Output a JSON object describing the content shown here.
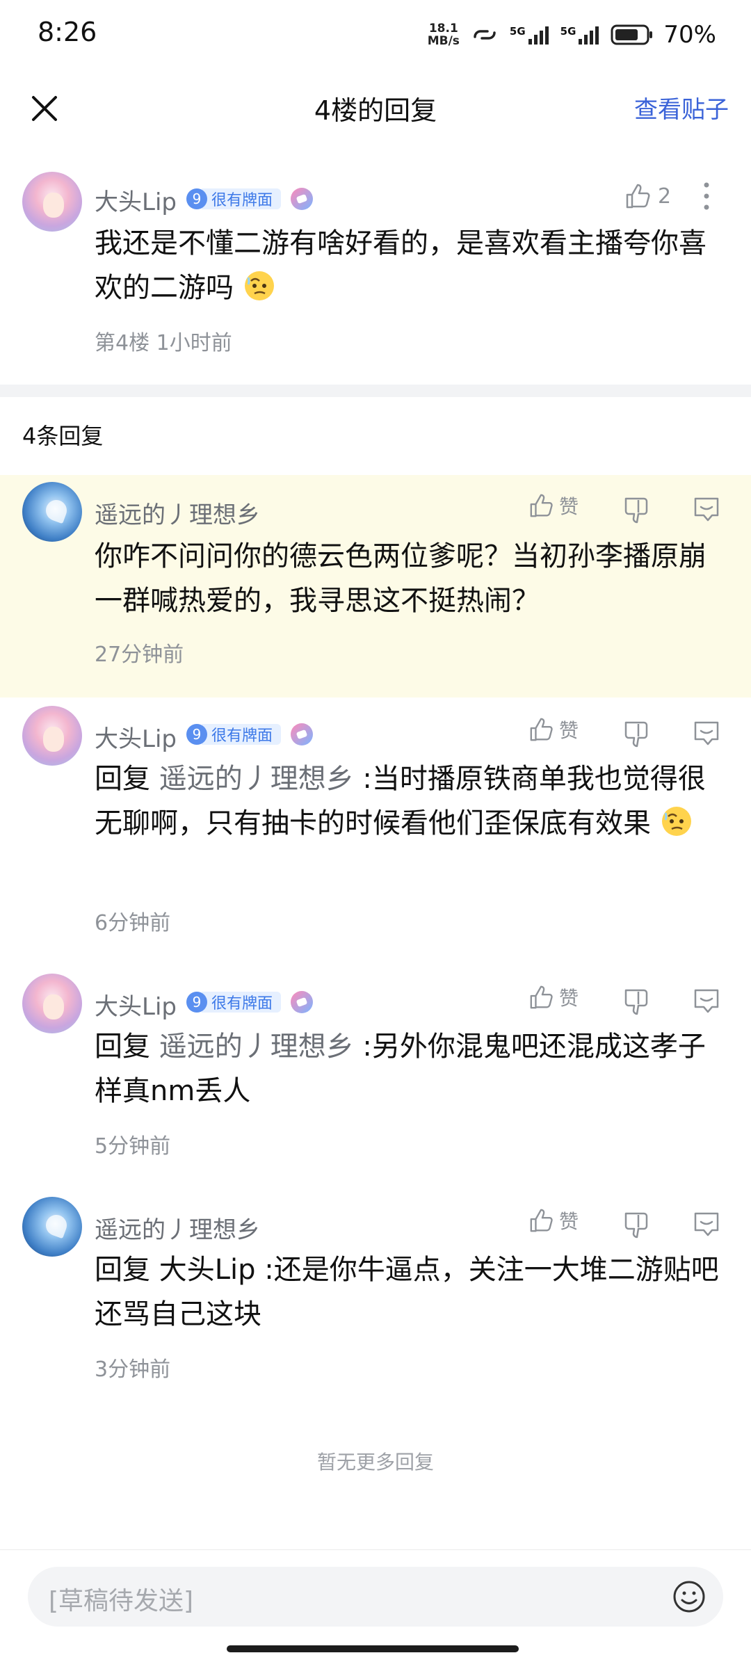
{
  "status_bar": {
    "time": "8:26",
    "net_speed_value": "18.1",
    "net_speed_unit": "MB/s",
    "signal1_label": "5G",
    "signal2_label": "5G",
    "battery_percent": "70%"
  },
  "header": {
    "title": "4楼的回复",
    "view_post_label": "查看贴子"
  },
  "main_post": {
    "username": "大头Lip",
    "badge_level": "9",
    "badge_text": "很有牌面",
    "like_count": "2",
    "content": "我还是不懂二游有啥好看的，是喜欢看主播夸你喜欢的二游吗",
    "meta": "第4楼 1小时前"
  },
  "replies_header": {
    "count_label": "4条回复"
  },
  "replies": [
    {
      "username": "遥远的丿理想乡",
      "like_label": "赞",
      "content": "你咋不问问你的德云色两位爹呢？当初孙李播原崩一群喊热爱的，我寻思这不挺热闹？",
      "time": "27分钟前"
    },
    {
      "username": "大头Lip",
      "badge_level": "9",
      "badge_text": "很有牌面",
      "like_label": "赞",
      "reply_prefix": "回复 ",
      "reply_target": "遥远的丿理想乡",
      "content": " :当时播原铁商单我也觉得很无聊啊，只有抽卡的时候看他们歪保底有效果",
      "time": "6分钟前"
    },
    {
      "username": "大头Lip",
      "badge_level": "9",
      "badge_text": "很有牌面",
      "like_label": "赞",
      "reply_prefix": "回复 ",
      "reply_target": "遥远的丿理想乡",
      "content": " :另外你混鬼吧还混成这孝子样真nm丢人",
      "time": "5分钟前"
    },
    {
      "username": "遥远的丿理想乡",
      "like_label": "赞",
      "reply_prefix": "回复 大头Lip",
      "content": " :还是你牛逼点，关注一大堆二游贴吧还骂自己这块",
      "time": "3分钟前"
    }
  ],
  "footer": {
    "no_more_label": "暂无更多回复",
    "input_placeholder": "[草稿待发送]"
  },
  "colors": {
    "accent_link": "#3b63d8",
    "highlight_bg": "#fdfbe7",
    "badge_blue": "#5a8ff0"
  }
}
